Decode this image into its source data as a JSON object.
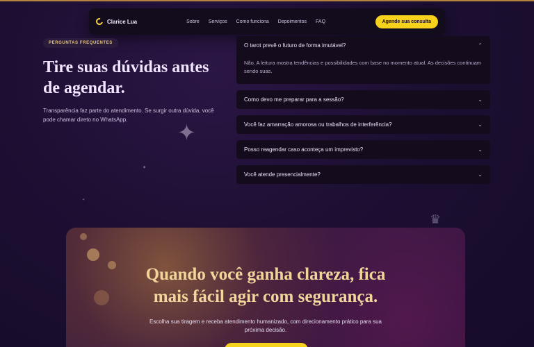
{
  "header": {
    "brand": "Clarice Lua",
    "nav": [
      "Sobre",
      "Serviços",
      "Como funciona",
      "Depoimentos",
      "FAQ"
    ],
    "cta": "Agende sua consulta"
  },
  "faq": {
    "badge": "PERGUNTAS FREQUENTES",
    "title": "Tire suas dúvidas antes de agendar.",
    "description": "Transparência faz parte do atendimento. Se surgir outra dúvida, você pode chamar direto no WhatsApp.",
    "items": [
      {
        "question": "O tarot prevê o futuro de forma imutável?",
        "answer": "Não. A leitura mostra tendências e possibilidades com base no momento atual. As decisões continuam sendo suas.",
        "open": true
      },
      {
        "question": "Como devo me preparar para a sessão?",
        "open": false
      },
      {
        "question": "Você faz amarração amorosa ou trabalhos de interferência?",
        "open": false
      },
      {
        "question": "Posso reagendar caso aconteça um imprevisto?",
        "open": false
      },
      {
        "question": "Você atende presencialmente?",
        "open": false
      }
    ]
  },
  "hero": {
    "title_line1": "Quando você ganha clareza, fica",
    "title_line2": "mais fácil agir com segurança.",
    "description": "Escolha sua tiragem e receba atendimento humanizado, com direcionamento prático para sua próxima decisão."
  },
  "colors": {
    "accent": "#f7d21c",
    "gold_text": "#f1d59a",
    "background": "#1d0f33"
  },
  "icons": {
    "brand": "moon-icon",
    "open_item": "chevron-up-icon",
    "closed_item": "chevron-down-icon",
    "decoration": "sparkle-icon"
  }
}
